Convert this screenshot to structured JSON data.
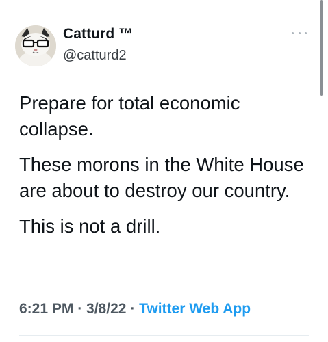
{
  "author": {
    "display_name": "Catturd ™",
    "handle": "@catturd2"
  },
  "icons": {
    "more": "more-horizontal-icon",
    "avatar": "avatar-cat-with-glasses"
  },
  "tweet": {
    "paragraphs": [
      "Prepare for total economic collapse.",
      "These morons in the White House are about to destroy our country.",
      "This is not a drill."
    ]
  },
  "meta": {
    "time": "6:21 PM",
    "sep1": " · ",
    "date": "3/8/22",
    "sep2": " · ",
    "source": "Twitter Web App"
  },
  "colors": {
    "text": "#0f1419",
    "meta": "#4e5861",
    "link": "#1d9bf0"
  }
}
